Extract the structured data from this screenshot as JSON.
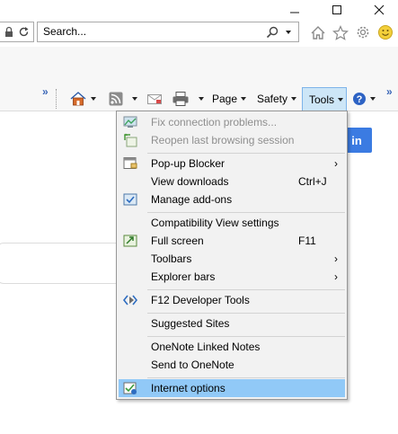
{
  "window": {
    "minimize_label": "Minimize",
    "maximize_label": "Maximize",
    "close_label": "Close"
  },
  "address": {
    "search_placeholder": "Search..."
  },
  "command_bar": {
    "page_label": "Page",
    "safety_label": "Safety",
    "tools_label": "Tools",
    "overflow_left": "»",
    "overflow_right": "»"
  },
  "page": {
    "signin_button": "in"
  },
  "tools_menu": {
    "items": [
      {
        "label": "Fix connection problems...",
        "disabled": true,
        "icon": "network-repair-icon"
      },
      {
        "label": "Reopen last browsing session",
        "disabled": true,
        "icon": "reopen-session-icon"
      },
      {
        "label": "Pop-up Blocker",
        "submenu": true,
        "icon": "popup-blocker-icon"
      },
      {
        "label": "View downloads",
        "shortcut": "Ctrl+J"
      },
      {
        "label": "Manage add-ons",
        "icon": "addons-icon"
      },
      {
        "label": "Compatibility View settings"
      },
      {
        "label": "Full screen",
        "shortcut": "F11",
        "icon": "fullscreen-icon"
      },
      {
        "label": "Toolbars",
        "submenu": true
      },
      {
        "label": "Explorer bars",
        "submenu": true
      },
      {
        "label": "F12 Developer Tools",
        "icon": "developer-tools-icon"
      },
      {
        "label": "Suggested Sites"
      },
      {
        "label": "OneNote Linked Notes"
      },
      {
        "label": "Send to OneNote"
      },
      {
        "label": "Internet options",
        "highlighted": true,
        "icon": "internet-options-icon"
      }
    ],
    "submenu_arrow": "›"
  },
  "colors": {
    "accent_blue": "#3b7be2",
    "menu_highlight": "#91c9f7",
    "active_button": "#cde6f7"
  }
}
